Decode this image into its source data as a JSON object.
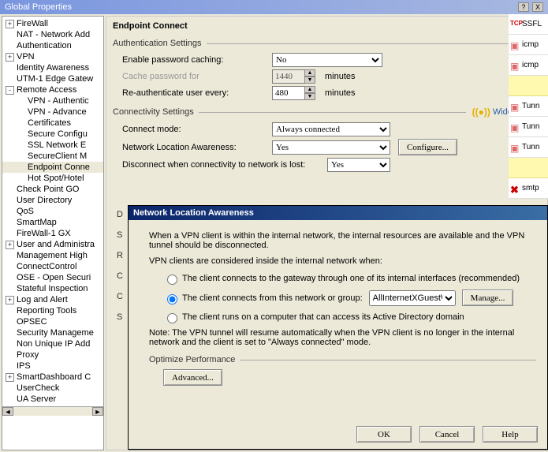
{
  "window_title": "Global Properties",
  "titlebar_buttons": {
    "help": "?",
    "close": "X"
  },
  "tree": [
    {
      "lvl": 1,
      "exp": "+",
      "label": "FireWall"
    },
    {
      "lvl": 1,
      "exp": "",
      "label": "NAT - Network Add"
    },
    {
      "lvl": 1,
      "exp": "",
      "label": "Authentication"
    },
    {
      "lvl": 1,
      "exp": "+",
      "label": "VPN"
    },
    {
      "lvl": 1,
      "exp": "",
      "label": "Identity Awareness"
    },
    {
      "lvl": 1,
      "exp": "",
      "label": "UTM-1 Edge Gatew"
    },
    {
      "lvl": 1,
      "exp": "-",
      "label": "Remote Access"
    },
    {
      "lvl": 2,
      "exp": "",
      "label": "VPN - Authentic"
    },
    {
      "lvl": 2,
      "exp": "",
      "label": "VPN - Advance"
    },
    {
      "lvl": 2,
      "exp": "",
      "label": "Certificates"
    },
    {
      "lvl": 2,
      "exp": "",
      "label": "Secure Configu"
    },
    {
      "lvl": 2,
      "exp": "",
      "label": "SSL Network E"
    },
    {
      "lvl": 2,
      "exp": "",
      "label": "SecureClient M"
    },
    {
      "lvl": 2,
      "exp": "",
      "label": "Endpoint Conne",
      "selected": true
    },
    {
      "lvl": 2,
      "exp": "",
      "label": "Hot Spot/Hotel"
    },
    {
      "lvl": 1,
      "exp": "",
      "label": "Check Point GO"
    },
    {
      "lvl": 1,
      "exp": "",
      "label": "User Directory"
    },
    {
      "lvl": 1,
      "exp": "",
      "label": "QoS"
    },
    {
      "lvl": 1,
      "exp": "",
      "label": "SmartMap"
    },
    {
      "lvl": 1,
      "exp": "",
      "label": "FireWall-1 GX"
    },
    {
      "lvl": 1,
      "exp": "+",
      "label": "User and Administra"
    },
    {
      "lvl": 1,
      "exp": "",
      "label": "Management High "
    },
    {
      "lvl": 1,
      "exp": "",
      "label": "ConnectControl"
    },
    {
      "lvl": 1,
      "exp": "",
      "label": "OSE - Open Securi"
    },
    {
      "lvl": 1,
      "exp": "",
      "label": "Stateful Inspection"
    },
    {
      "lvl": 1,
      "exp": "+",
      "label": "Log and Alert"
    },
    {
      "lvl": 1,
      "exp": "",
      "label": "Reporting Tools"
    },
    {
      "lvl": 1,
      "exp": "",
      "label": "OPSEC"
    },
    {
      "lvl": 1,
      "exp": "",
      "label": "Security Manageme"
    },
    {
      "lvl": 1,
      "exp": "",
      "label": "Non Unique IP Add"
    },
    {
      "lvl": 1,
      "exp": "",
      "label": "Proxy"
    },
    {
      "lvl": 1,
      "exp": "",
      "label": "IPS"
    },
    {
      "lvl": 1,
      "exp": "+",
      "label": "SmartDashboard C"
    },
    {
      "lvl": 1,
      "exp": "",
      "label": "UserCheck"
    },
    {
      "lvl": 1,
      "exp": "",
      "label": "UA Server"
    }
  ],
  "tree_scroll": {
    "left": "◄",
    "right": "►"
  },
  "page": {
    "title": "Endpoint Connect",
    "auth_group": "Authentication Settings",
    "enable_caching_label": "Enable password caching:",
    "enable_caching_value": "No",
    "cache_for_label": "Cache password for",
    "cache_for_value": "1440",
    "cache_for_unit": "minutes",
    "reauth_label": "Re-authenticate user every:",
    "reauth_value": "480",
    "reauth_unit": "minutes",
    "conn_group": "Connectivity Settings",
    "wide_impact": "Wide Impact",
    "connect_mode_label": "Connect mode:",
    "connect_mode_value": "Always connected",
    "nla_label": "Network Location Awareness:",
    "nla_value": "Yes",
    "configure_btn": "Configure...",
    "disconnect_label": "Disconnect when connectivity to network is lost:",
    "disconnect_value": "Yes"
  },
  "truncated_letters": [
    "D",
    "S",
    "R",
    "C",
    "C",
    "S"
  ],
  "dialog": {
    "title": "Network Location Awareness",
    "para1": "When a VPN client is within the internal network, the internal resources are available and the VPN tunnel should be disconnected.",
    "para2": "VPN clients are considered inside the internal network when:",
    "opt1": "The client connects to the gateway through one of its internal interfaces (recommended)",
    "opt2": "The client connects from this network or group:",
    "opt2_combo": "AllInternetXGuestW",
    "manage_btn": "Manage...",
    "opt3": "The client runs on a computer that can access its Active Directory domain",
    "note": "Note: The VPN tunnel will resume automatically when the VPN client is no longer in the internal network and the client is set to \"Always connected\" mode.",
    "optimize_group": "Optimize Performance",
    "advanced_btn": "Advanced...",
    "ok": "OK",
    "cancel": "Cancel",
    "help": "Help"
  },
  "rightstrip": [
    {
      "icon": "tcp",
      "label": "SSFL",
      "yel": false
    },
    {
      "icon": "pink",
      "label": "icmp",
      "yel": false
    },
    {
      "icon": "pink",
      "label": "icmp",
      "yel": false
    },
    {
      "icon": "",
      "label": "",
      "yel": true
    },
    {
      "icon": "pink",
      "label": "Tunn",
      "yel": false
    },
    {
      "icon": "pink",
      "label": "Tunn",
      "yel": false
    },
    {
      "icon": "pink",
      "label": "Tunn",
      "yel": false
    },
    {
      "icon": "",
      "label": "",
      "yel": true
    },
    {
      "icon": "x",
      "label": "smtp",
      "yel": false
    }
  ]
}
